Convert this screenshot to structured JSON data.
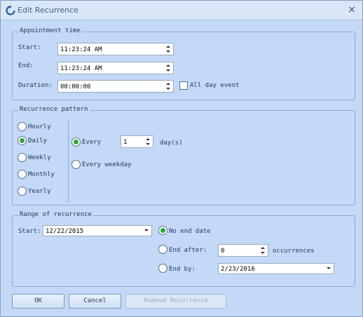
{
  "window": {
    "title": "Edit Recurrence",
    "close_glyph": "×"
  },
  "appointment": {
    "group_label": "Appointment time",
    "start_label": "Start:",
    "start_value": "11:23:24 AM",
    "end_label": "End:",
    "end_value": "11:23:24 AM",
    "duration_label": "Duration:",
    "duration_value": "00:00:00",
    "all_day_label": "All day event",
    "all_day_checked": false
  },
  "pattern": {
    "group_label": "Recurrence pattern",
    "options": [
      "Hourly",
      "Daily",
      "Weekly",
      "Monthly",
      "Yearly"
    ],
    "selected": "Daily",
    "every_label": "Every",
    "every_value": "1",
    "days_label": "day(s)",
    "every_weekday_label": "Every weekday",
    "daily_mode": "Every"
  },
  "range": {
    "group_label": "Range of recurrence",
    "start_label": "Start:",
    "start_value": "12/22/2015",
    "no_end_label": "No end date",
    "end_after_label": "End after:",
    "end_after_value": "0",
    "occurrences_label": "occurrences",
    "end_by_label": "End by:",
    "end_by_value": "2/23/2016",
    "selected": "No end date"
  },
  "buttons": {
    "ok": "OK",
    "cancel": "Cancel",
    "remove": "Remove Recurrence",
    "remove_enabled": false
  },
  "icons": {
    "title": "recurrence-icon",
    "close": "close-icon"
  },
  "colors": {
    "background": "#c3d9f7",
    "radio_selected": "#2aa63a",
    "text": "#1e395b"
  }
}
